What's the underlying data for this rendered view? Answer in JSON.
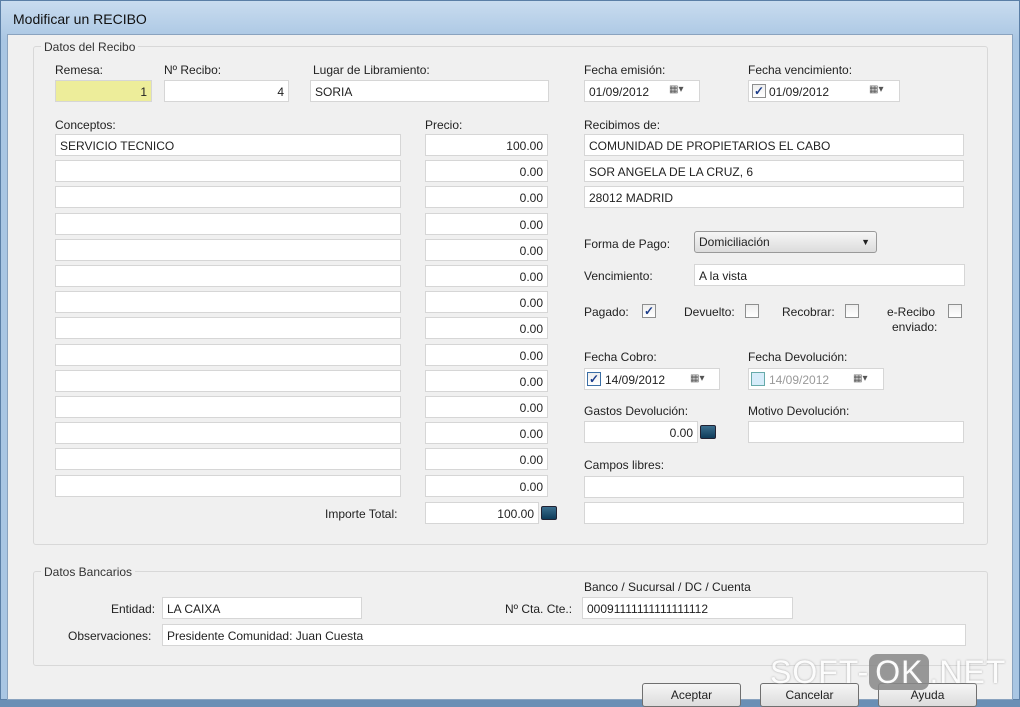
{
  "window": {
    "title": "Modificar un RECIBO"
  },
  "datos_recibo": {
    "group_label": "Datos del Recibo",
    "remesa_label": "Remesa:",
    "remesa": "1",
    "nrecibo_label": "Nº Recibo:",
    "nrecibo": "4",
    "lugar_label": "Lugar de Libramiento:",
    "lugar": "SORIA",
    "fecha_emision_label": "Fecha emisión:",
    "fecha_emision": "01/09/2012",
    "fecha_venc_label": "Fecha vencimiento:",
    "fecha_venc": "01/09/2012",
    "fecha_venc_checked": true,
    "conceptos_label": "Conceptos:",
    "precio_label": "Precio:",
    "conceptos": [
      "SERVICIO TECNICO",
      "",
      "",
      "",
      "",
      "",
      "",
      "",
      "",
      "",
      "",
      "",
      "",
      ""
    ],
    "precios": [
      "100.00",
      "0.00",
      "0.00",
      "0.00",
      "0.00",
      "0.00",
      "0.00",
      "0.00",
      "0.00",
      "0.00",
      "0.00",
      "0.00",
      "0.00",
      "0.00"
    ],
    "importe_label": "Importe Total:",
    "importe": "100.00",
    "recibimos_label": "Recibimos de:",
    "recibimos": [
      "COMUNIDAD DE PROPIETARIOS EL CABO",
      "SOR ANGELA DE LA CRUZ, 6",
      "28012 MADRID"
    ],
    "forma_pago_label": "Forma de Pago:",
    "forma_pago": "Domiciliación",
    "vencimiento_label": "Vencimiento:",
    "vencimiento": "A la vista",
    "pagado_label": "Pagado:",
    "pagado": true,
    "devuelto_label": "Devuelto:",
    "devuelto": false,
    "recobrar_label": "Recobrar:",
    "recobrar": false,
    "erecibo_label1": "e-Recibo",
    "erecibo_label2": "enviado:",
    "erecibo": false,
    "fecha_cobro_label": "Fecha Cobro:",
    "fecha_cobro": "14/09/2012",
    "fecha_cobro_checked": true,
    "fecha_dev_label": "Fecha Devolución:",
    "fecha_dev": "14/09/2012",
    "fecha_dev_checked": false,
    "gastos_dev_label": "Gastos Devolución:",
    "gastos_dev": "0.00",
    "motivo_dev_label": "Motivo Devolución:",
    "motivo_dev": "",
    "campos_libres_label": "Campos libres:",
    "campos_libres": [
      "",
      ""
    ]
  },
  "datos_bancarios": {
    "group_label": "Datos Bancarios",
    "entidad_label": "Entidad:",
    "entidad": "LA CAIXA",
    "cuenta_header": "Banco / Sucursal / DC / Cuenta",
    "cuenta_label": "Nº Cta. Cte.:",
    "cuenta": "00091111111111111112",
    "observaciones_label": "Observaciones:",
    "observaciones": "Presidente Comunidad: Juan Cuesta"
  },
  "buttons": {
    "aceptar": "Aceptar",
    "cancelar": "Cancelar",
    "ayuda": "Ayuda"
  },
  "watermark": {
    "a": "SOFT-",
    "b": "OK",
    ".c": "",
    "c": ".NET"
  }
}
